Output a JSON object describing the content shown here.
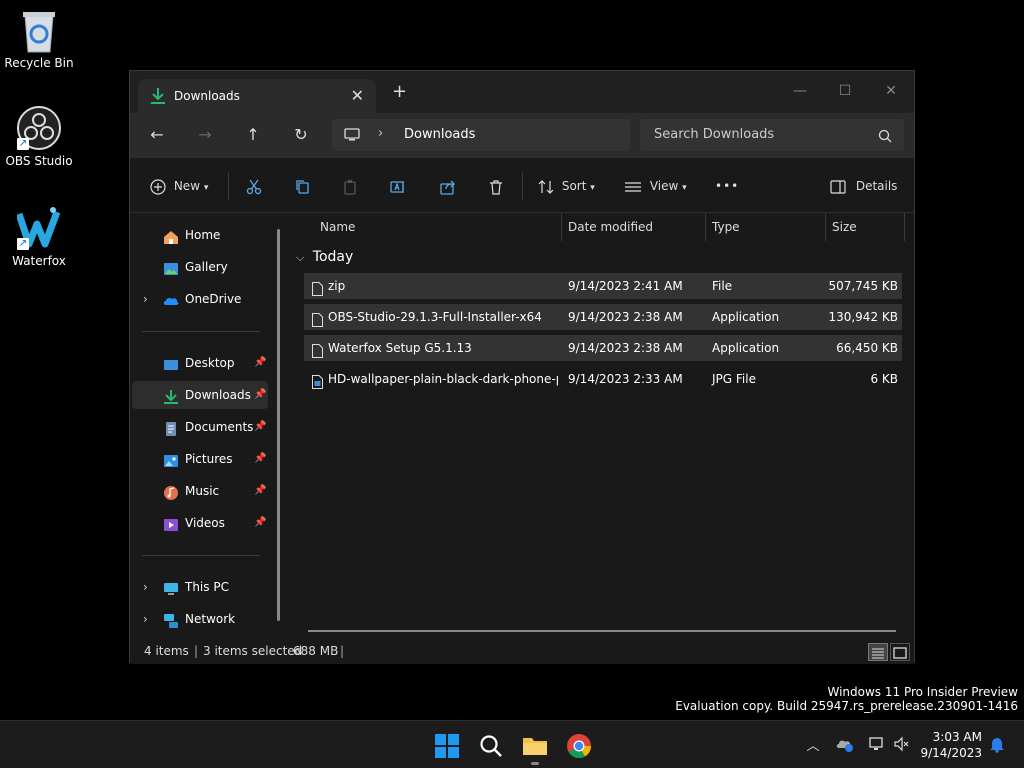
{
  "desktop": {
    "icons": [
      {
        "label": "Recycle Bin"
      },
      {
        "label": "OBS Studio"
      },
      {
        "label": "Waterfox"
      }
    ]
  },
  "window": {
    "tab_title": "Downloads",
    "tab_close": "✕",
    "new_tab": "+",
    "controls": {
      "minimize": "—",
      "maximize": "☐",
      "close": "✕"
    }
  },
  "navbar": {
    "back": "←",
    "forward": "→",
    "up": "↑",
    "refresh": "↻",
    "breadcrumb_sep": "›",
    "breadcrumb": "Downloads",
    "search_placeholder": "Search Downloads"
  },
  "toolbar": {
    "new_label": "New",
    "sort_label": "Sort",
    "view_label": "View",
    "more_label": "•••",
    "details_label": "Details"
  },
  "sidebar": {
    "items": [
      {
        "label": "Home"
      },
      {
        "label": "Gallery"
      },
      {
        "label": "OneDrive"
      },
      {
        "label": "Desktop"
      },
      {
        "label": "Downloads"
      },
      {
        "label": "Documents"
      },
      {
        "label": "Pictures"
      },
      {
        "label": "Music"
      },
      {
        "label": "Videos"
      },
      {
        "label": "This PC"
      },
      {
        "label": "Network"
      }
    ]
  },
  "content": {
    "columns": {
      "name": "Name",
      "date": "Date modified",
      "type": "Type",
      "size": "Size"
    },
    "group_label": "Today",
    "files": [
      {
        "name": "zip",
        "date": "9/14/2023 2:41 AM",
        "type": "File",
        "size": "507,745 KB",
        "selected": true
      },
      {
        "name": "OBS-Studio-29.1.3-Full-Installer-x64",
        "date": "9/14/2023 2:38 AM",
        "type": "Application",
        "size": "130,942 KB",
        "selected": true
      },
      {
        "name": "Waterfox Setup G5.1.13",
        "date": "9/14/2023 2:38 AM",
        "type": "Application",
        "size": "66,450 KB",
        "selected": true
      },
      {
        "name": "HD-wallpaper-plain-black-dark-phone-p...",
        "date": "9/14/2023 2:33 AM",
        "type": "JPG File",
        "size": "6 KB",
        "selected": false
      }
    ]
  },
  "status": {
    "items_count": "4 items",
    "selected": "3 items selected",
    "size": "688 MB"
  },
  "watermark": {
    "line1": "Windows 11 Pro Insider Preview",
    "line2": "Evaluation copy. Build 25947.rs_prerelease.230901-1416"
  },
  "taskbar": {
    "time": "3:03 AM",
    "date": "9/14/2023"
  },
  "colors": {
    "accent": "#2bb673",
    "folder": "#f3c143",
    "selection": "#333333"
  }
}
